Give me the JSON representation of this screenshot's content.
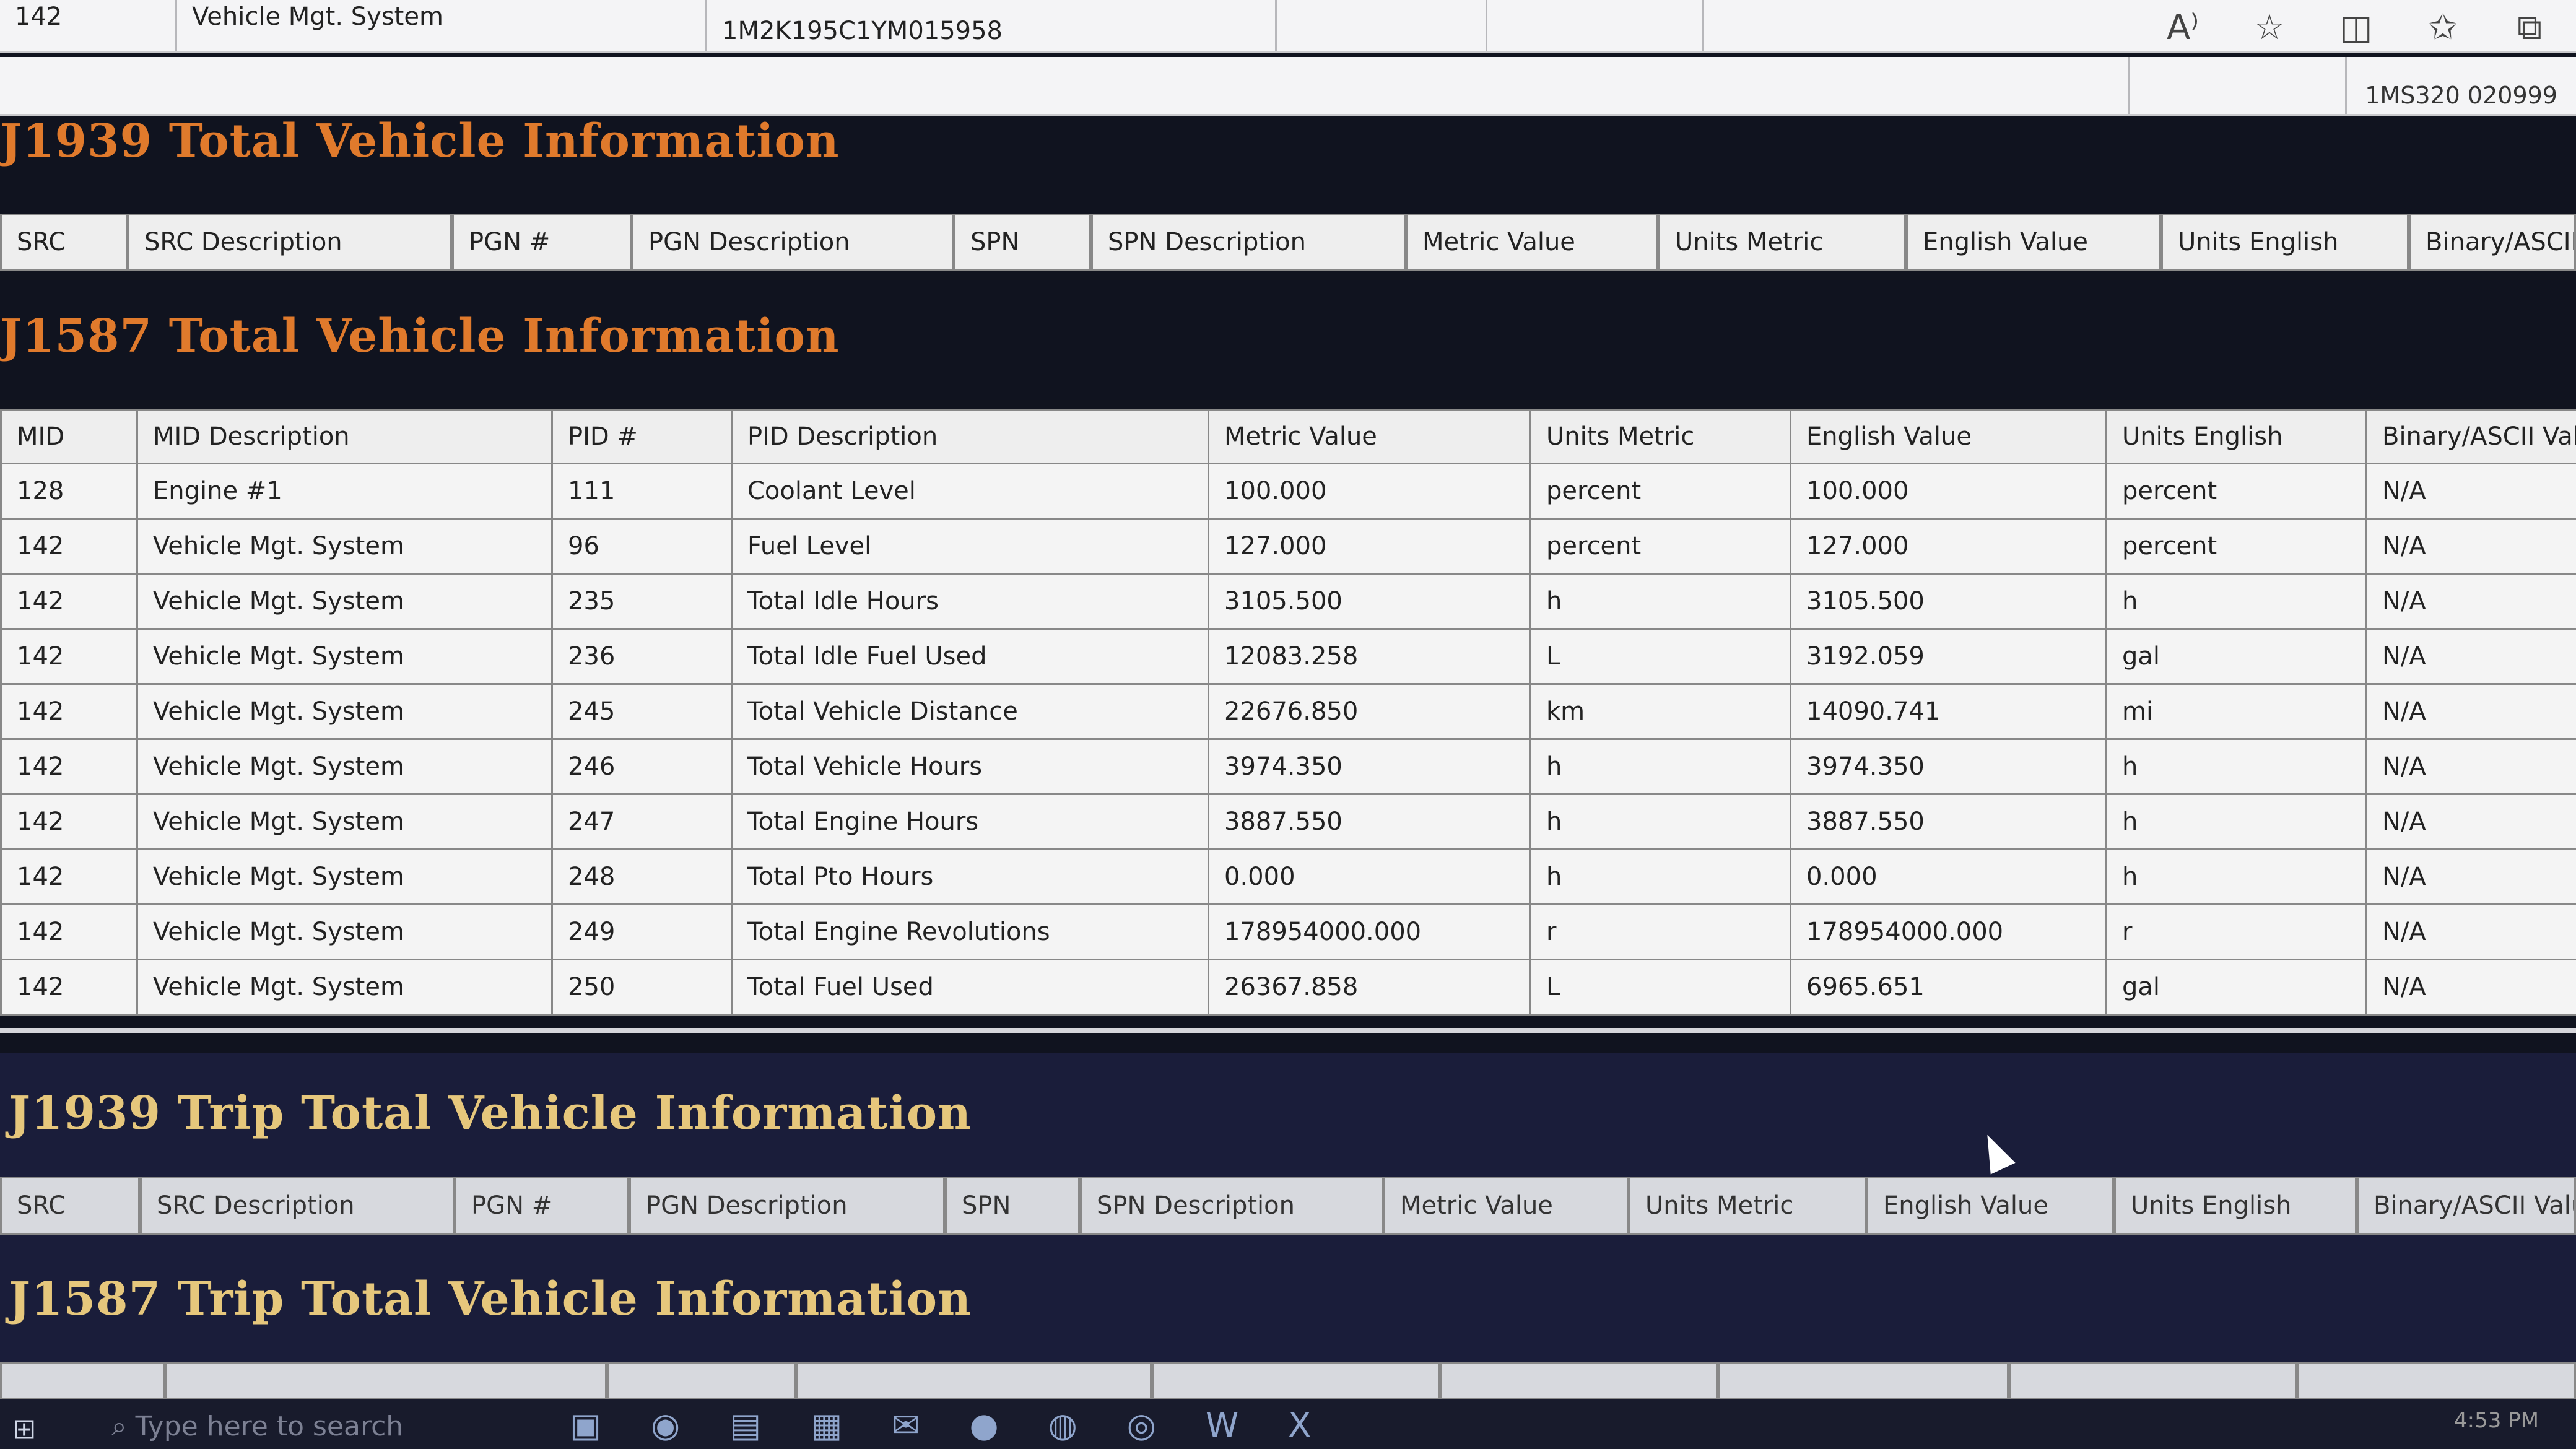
{
  "window": {
    "top_cells": [
      "142",
      "Vehicle Mgt. System",
      "1M2K195C1YM015958"
    ],
    "vin_secondary": "1MS320 020999",
    "top_icons": [
      "read-aloud-icon",
      "favorite-star-icon",
      "split-view-icon",
      "favorites-icon",
      "collections-icon"
    ]
  },
  "sections": {
    "j1939_total": "J1939 Total Vehicle Information",
    "j1587_total": "J1587 Total Vehicle Information",
    "j1939_trip": "J1939 Trip Total Vehicle Information",
    "j1587_trip": "J1587 Trip Total Vehicle Information"
  },
  "j1939_headers": [
    "SRC",
    "SRC Description",
    "PGN #",
    "PGN Description",
    "SPN",
    "SPN Description",
    "Metric Value",
    "Units Metric",
    "English Value",
    "Units English",
    "Binary/ASCII Value"
  ],
  "j1587_headers": [
    "MID",
    "MID Description",
    "PID #",
    "PID Description",
    "Metric Value",
    "Units Metric",
    "English Value",
    "Units English",
    "Binary/ASCII Value"
  ],
  "j1587_rows": [
    [
      "128",
      "Engine #1",
      "111",
      "Coolant Level",
      "100.000",
      "percent",
      "100.000",
      "percent",
      "N/A"
    ],
    [
      "142",
      "Vehicle Mgt. System",
      "96",
      "Fuel Level",
      "127.000",
      "percent",
      "127.000",
      "percent",
      "N/A"
    ],
    [
      "142",
      "Vehicle Mgt. System",
      "235",
      "Total Idle Hours",
      "3105.500",
      "h",
      "3105.500",
      "h",
      "N/A"
    ],
    [
      "142",
      "Vehicle Mgt. System",
      "236",
      "Total Idle Fuel Used",
      "12083.258",
      "L",
      "3192.059",
      "gal",
      "N/A"
    ],
    [
      "142",
      "Vehicle Mgt. System",
      "245",
      "Total Vehicle Distance",
      "22676.850",
      "km",
      "14090.741",
      "mi",
      "N/A"
    ],
    [
      "142",
      "Vehicle Mgt. System",
      "246",
      "Total Vehicle Hours",
      "3974.350",
      "h",
      "3974.350",
      "h",
      "N/A"
    ],
    [
      "142",
      "Vehicle Mgt. System",
      "247",
      "Total Engine Hours",
      "3887.550",
      "h",
      "3887.550",
      "h",
      "N/A"
    ],
    [
      "142",
      "Vehicle Mgt. System",
      "248",
      "Total Pto Hours",
      "0.000",
      "h",
      "0.000",
      "h",
      "N/A"
    ],
    [
      "142",
      "Vehicle Mgt. System",
      "249",
      "Total Engine Revolutions",
      "178954000.000",
      "r",
      "178954000.000",
      "r",
      "N/A"
    ],
    [
      "142",
      "Vehicle Mgt. System",
      "250",
      "Total Fuel Used",
      "26367.858",
      "L",
      "6965.651",
      "gal",
      "N/A"
    ]
  ],
  "taskbar": {
    "search_placeholder": "Type here to search",
    "clock": "4:53 PM"
  }
}
